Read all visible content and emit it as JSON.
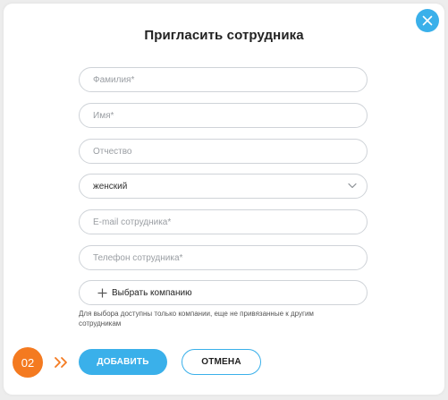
{
  "dialog": {
    "title": "Пригласить сотрудника",
    "close_icon": "close-icon"
  },
  "form": {
    "last_name": {
      "placeholder": "Фамилия*",
      "value": ""
    },
    "first_name": {
      "placeholder": "Имя*",
      "value": ""
    },
    "middle_name": {
      "placeholder": "Отчество",
      "value": ""
    },
    "gender": {
      "selected": "женский",
      "icon": "chevron-down-icon"
    },
    "email": {
      "placeholder": "E-mail сотрудника*",
      "value": ""
    },
    "phone": {
      "placeholder": "Телефон сотрудника*",
      "value": ""
    },
    "company": {
      "label": "Выбрать компанию",
      "icon": "plus-icon"
    },
    "company_hint": "Для выбора доступны только компании, еще не привязанные к другим сотрудникам"
  },
  "footer": {
    "step_badge": "02",
    "arrows_icon": "double-chevron-right-icon",
    "submit_label": "ДОБАВИТЬ",
    "cancel_label": "ОТМЕНА"
  },
  "colors": {
    "accent": "#3ab0ea",
    "step": "#f47a20",
    "border": "#cfd3d8"
  }
}
